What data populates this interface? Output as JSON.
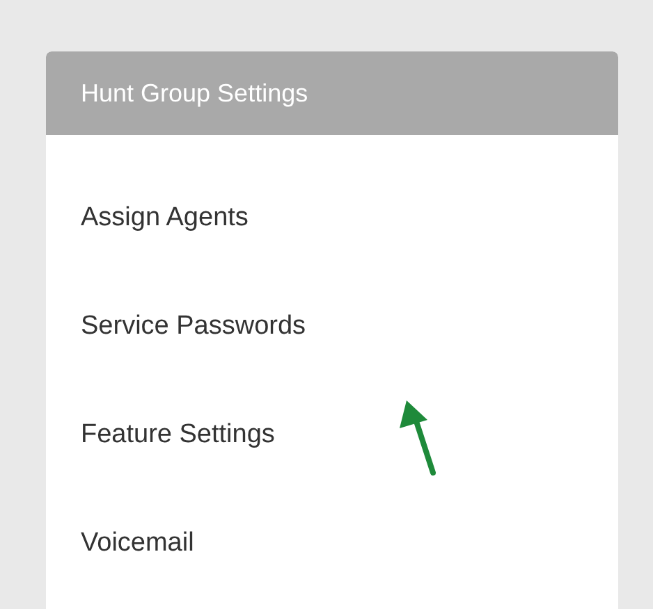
{
  "panel": {
    "title": "Hunt Group Settings"
  },
  "items": [
    {
      "label": "Assign Agents",
      "annotated": false
    },
    {
      "label": "Service Passwords",
      "annotated": false
    },
    {
      "label": "Feature Settings",
      "annotated": true
    },
    {
      "label": "Voicemail",
      "annotated": false
    }
  ]
}
